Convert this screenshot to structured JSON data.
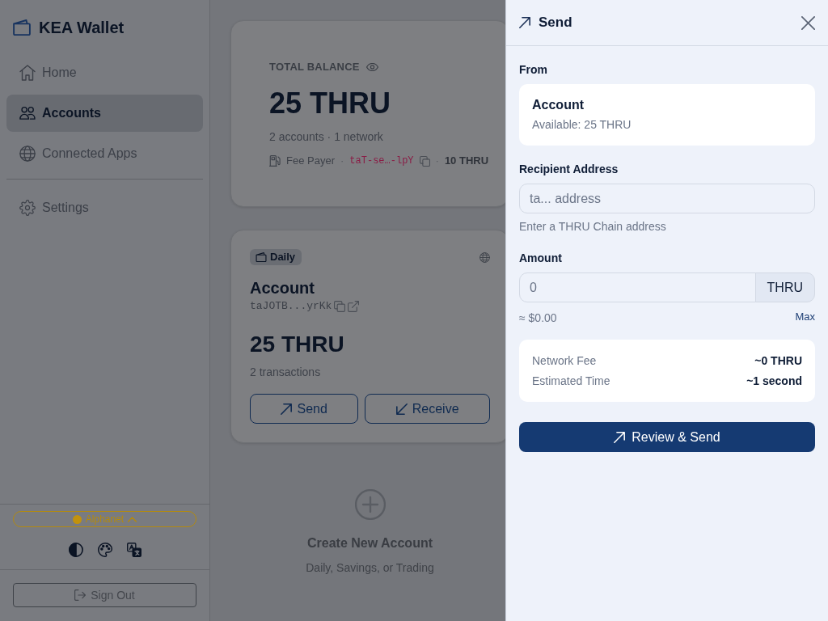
{
  "sidebar": {
    "brand": "KEA Wallet",
    "nav": [
      {
        "label": "Home",
        "selected": false
      },
      {
        "label": "Accounts",
        "selected": true
      },
      {
        "label": "Connected Apps",
        "selected": false
      }
    ],
    "secondary_nav": [
      {
        "label": "Settings",
        "selected": false
      }
    ],
    "network": "Alphanet",
    "sign_out": "Sign Out"
  },
  "portfolio": {
    "label": "TOTAL BALANCE",
    "amount": "25 THRU",
    "summary": "2 accounts · 1 network",
    "fee_payer": {
      "label": "Fee Payer",
      "separators": [
        "·",
        "·"
      ],
      "address": "taT-se…-lpY",
      "balance": "10 THRU"
    }
  },
  "accounts": [
    {
      "tag": "Daily",
      "name": "Account",
      "address": "taJOTB...yrKk",
      "balance": "25 THRU",
      "transactions": "2 transactions",
      "actions": [
        "Send",
        "Receive"
      ]
    }
  ],
  "create_account": {
    "title": "Create New Account",
    "subtitle": "Daily, Savings, or Trading"
  },
  "send_panel": {
    "title": "Send",
    "from": {
      "label": "From",
      "account": "Account",
      "available": "Available: 25 THRU"
    },
    "recipient": {
      "label": "Recipient Address",
      "placeholder": "ta... address",
      "help": "Enter a THRU Chain address"
    },
    "amount": {
      "label": "Amount",
      "placeholder": "0",
      "unit": "THRU",
      "fiat": "≈ $0.00",
      "max": "Max"
    },
    "details": [
      {
        "label": "Network Fee",
        "value": "~0 THRU"
      },
      {
        "label": "Estimated Time",
        "value": "~1 second"
      }
    ],
    "submit": "Review & Send"
  }
}
